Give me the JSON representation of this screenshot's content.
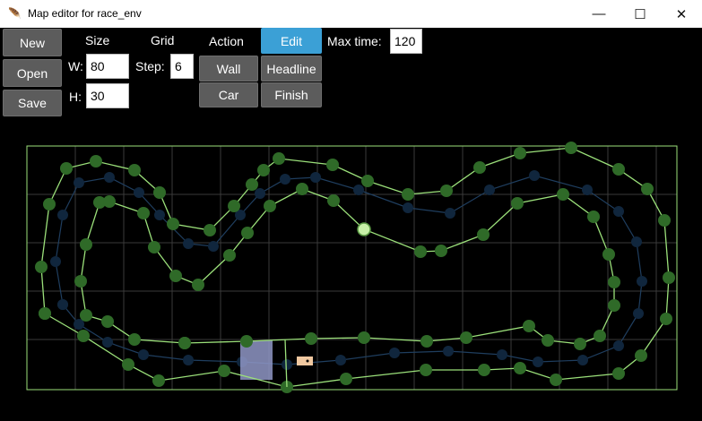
{
  "window": {
    "title": "Map editor for race_env",
    "icon": "tk-feather-icon",
    "minimize": "—",
    "maximize": "☐",
    "close": "✕"
  },
  "toolbar": {
    "file": {
      "new": "New",
      "open": "Open",
      "save": "Save"
    },
    "size": {
      "header": "Size",
      "w_label": "W:",
      "w_value": "80",
      "h_label": "H:",
      "h_value": "30"
    },
    "grid": {
      "header": "Grid",
      "step_label": "Step:",
      "step_value": "6"
    },
    "action": {
      "header": "Action",
      "edit": "Edit",
      "wall": "Wall",
      "headline": "Headline",
      "car": "Car",
      "finish": "Finish",
      "active": "Edit"
    },
    "max_time": {
      "label": "Max time:",
      "value": "120"
    }
  },
  "colors": {
    "background": "#000000",
    "grid": "#3a3a3a",
    "wall_outer": "#9be07a",
    "headline": "#1f3e5f",
    "node": "#2f6a28",
    "selected_node": "#c8f0a8",
    "finish_zone": "#8f97c6",
    "car": "#f0c8a0",
    "active_button": "#3ba0d6"
  }
}
